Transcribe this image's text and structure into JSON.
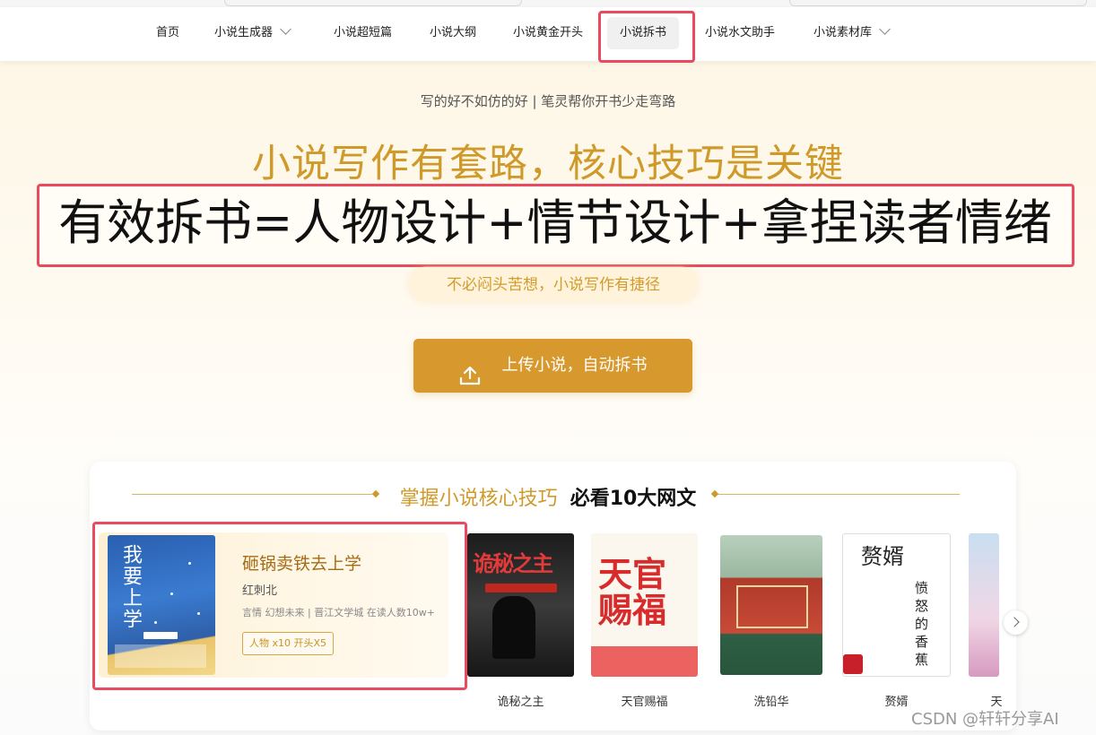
{
  "nav": {
    "items": [
      {
        "label": "首页"
      },
      {
        "label": "小说生成器"
      },
      {
        "label": "小说超短篇"
      },
      {
        "label": "小说大纲"
      },
      {
        "label": "小说黄金开头"
      },
      {
        "label": "小说拆书"
      },
      {
        "label": "小说水文助手"
      },
      {
        "label": "小说素材库"
      }
    ],
    "active_index": 5
  },
  "hero": {
    "tagline": "写的好不如仿的好 | 笔灵帮你开书少走弯路",
    "headline": "小说写作有套路，核心技巧是关键",
    "formula": "有效拆书=人物设计+情节设计+拿捏读者情绪",
    "subtitle": "不必闷头苦想，小说写作有捷径",
    "upload_button": "上传小说，自动拆书"
  },
  "section": {
    "title_accent": "掌握小说核心技巧",
    "title_rest": "必看10大网文"
  },
  "featured": {
    "cover_text": "我要上学",
    "title": "砸锅卖铁去上学",
    "author": "红刺北",
    "meta": "言情 幻想未来 | 晋江文学城 在读人数10w+",
    "tag": "人物 x10 开头X5"
  },
  "books": [
    {
      "name": "诡秘之主",
      "cover_text": "诡秘之主"
    },
    {
      "name": "天官赐福",
      "cover_text": "天官赐福"
    },
    {
      "name": "洗铅华",
      "cover_text": ""
    },
    {
      "name": "赘婿",
      "cover_text": "赘婿",
      "cover_text2": "愤怒的香蕉"
    },
    {
      "name": "天",
      "cover_text": ""
    }
  ],
  "watermark": "CSDN @轩轩分享AI",
  "colors": {
    "accent": "#d7992d",
    "highlight_box": "#e94a5d"
  }
}
